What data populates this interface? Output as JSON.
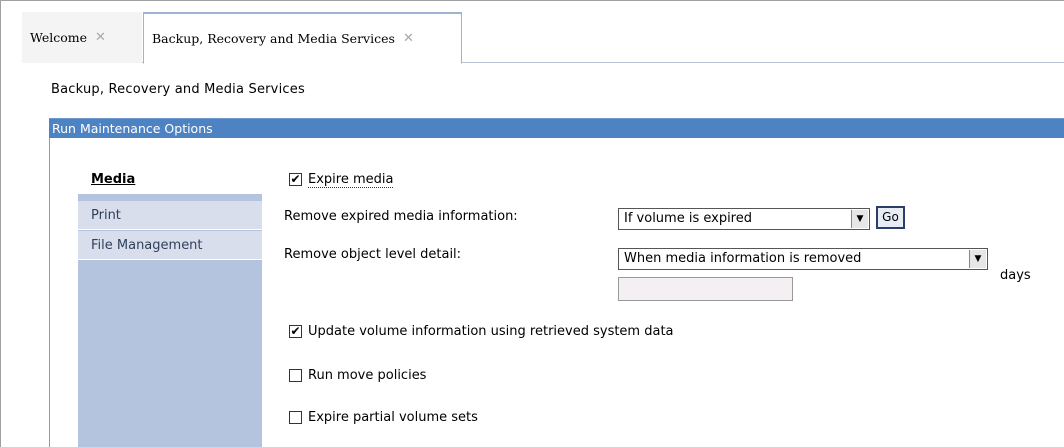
{
  "tabs": [
    {
      "label": "Welcome",
      "close": "✕"
    },
    {
      "label": "Backup, Recovery and Media Services",
      "close": "✕"
    }
  ],
  "page_title": "Backup, Recovery and Media Services",
  "section": {
    "title": "Run Maintenance Options"
  },
  "nav": {
    "items": [
      {
        "label": "Media"
      },
      {
        "label": "Print"
      },
      {
        "label": "File Management"
      }
    ]
  },
  "form": {
    "expire_media": {
      "label": "Expire media",
      "checked": true,
      "check": "✔"
    },
    "remove_expired": {
      "label": "Remove expired media information:",
      "value": "If volume is expired",
      "go_label": "Go"
    },
    "remove_object": {
      "label": "Remove object level detail:",
      "value": "When media information is removed",
      "days_value": "",
      "days_label": "days"
    },
    "update_volume": {
      "label": "Update volume information using retrieved system data",
      "checked": true,
      "check": "✔"
    },
    "run_move": {
      "label": "Run move policies",
      "checked": false
    },
    "expire_partial": {
      "label": "Expire partial volume sets",
      "checked": false
    }
  },
  "icons": {
    "dropdown": "▼"
  }
}
